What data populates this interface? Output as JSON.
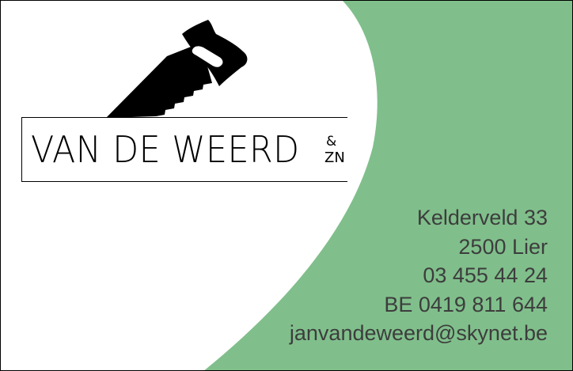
{
  "card": {
    "accent_color": "#80bf8b",
    "company": {
      "name": "VAN DE WEERD",
      "ampersand": "&",
      "suffix": "ZN",
      "logo": "hand-saw-icon"
    },
    "contact": {
      "street": "Kelderveld 33",
      "city": "2500 Lier",
      "phone": "03 455 44 24",
      "vat": "BE 0419 811 644",
      "email": "janvandeweerd@skynet.be"
    }
  }
}
